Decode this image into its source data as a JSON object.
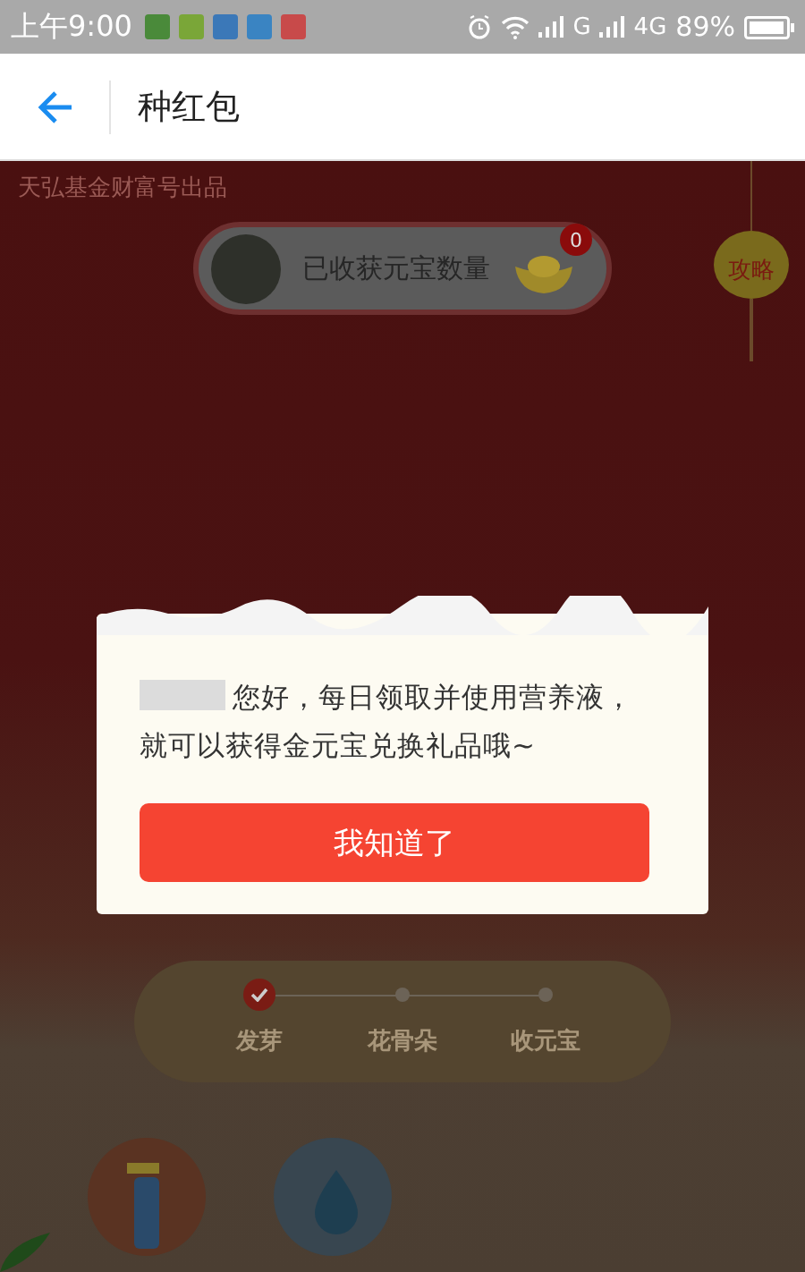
{
  "status_bar": {
    "time": "上午9:00",
    "network_1": "G",
    "network_2": "4G",
    "battery": "89%"
  },
  "header": {
    "title": "种红包"
  },
  "scene": {
    "credit": "天弘基金财富号出品",
    "harvest": {
      "label": "已收获元宝数量",
      "count": "0"
    },
    "guide": "攻略",
    "steps": [
      {
        "label": "发芽",
        "done": true
      },
      {
        "label": "花骨朵",
        "done": false
      },
      {
        "label": "收元宝",
        "done": false
      }
    ]
  },
  "dialog": {
    "message": "您好，每日领取并使用营养液，就可以获得金元宝兑换礼品哦~",
    "button": "我知道了"
  }
}
